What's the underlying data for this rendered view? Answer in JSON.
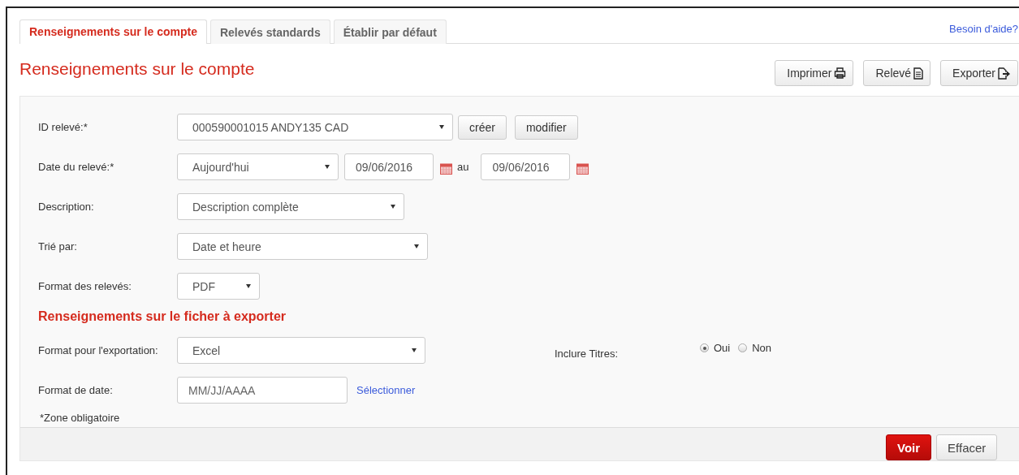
{
  "tabs": [
    {
      "label": "Renseignements sur le compte",
      "selected": true
    },
    {
      "label": "Relevés standards",
      "selected": false
    },
    {
      "label": "Établir par défaut",
      "selected": false
    }
  ],
  "help_link": "Besoin d'aide?",
  "title": "Renseignements sur le compte",
  "toolbar": [
    {
      "label": "Imprimer",
      "kind": "print"
    },
    {
      "label": "Relevé",
      "kind": "document"
    },
    {
      "label": "Exporter",
      "kind": "export"
    }
  ],
  "rows": [
    {
      "label": "ID relevé:*",
      "kind": "select-actions",
      "value": "000590001015 ANDY135 CAD",
      "buttons": [
        "créer",
        "modifier"
      ]
    },
    {
      "label": "Date du relevé:*",
      "kind": "date-range",
      "value": "Aujourd'hui",
      "from": "09/06/2016",
      "separator": "au",
      "to": "09/06/2016"
    },
    {
      "label": "Description:",
      "kind": "select",
      "value": "Description complète"
    },
    {
      "label": "Trié par:",
      "kind": "select",
      "value": "Date et heure"
    },
    {
      "label": "Format des relevés:",
      "kind": "select",
      "value": "PDF"
    }
  ],
  "export_section": {
    "heading": "Renseignements sur le ficher à exporter",
    "format": {
      "label": "Format pour l'exportation:",
      "value": "Excel"
    },
    "include_titles": {
      "label": "Inclure Titres:",
      "options": [
        {
          "label": "Oui",
          "selected": true
        },
        {
          "label": "Non",
          "selected": false
        }
      ]
    },
    "date_format": {
      "label": "Format de date:",
      "placeholder": "MM/JJ/AAAA",
      "link": "Sélectionner"
    }
  },
  "note": "*Zone obligatoire",
  "footer_buttons": [
    {
      "label": "Voir",
      "kind": "primary"
    },
    {
      "label": "Effacer",
      "kind": "secondary"
    }
  ]
}
